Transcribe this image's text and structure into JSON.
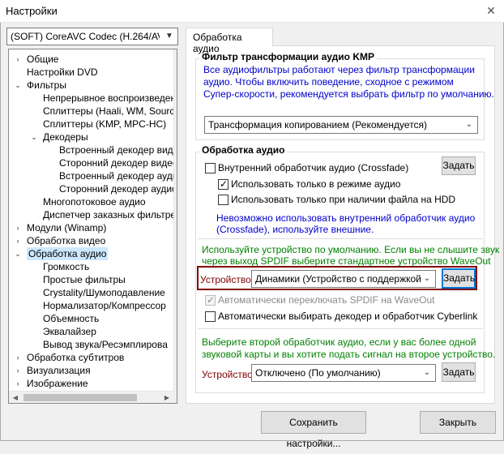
{
  "window": {
    "title": "Настройки",
    "close": "✕"
  },
  "codec_select": {
    "value": "(SOFT) CoreAVC Codec (H.264/AVC wit"
  },
  "tree": {
    "items": [
      {
        "label": "Общие",
        "expander": "›"
      },
      {
        "label": "Настройки DVD",
        "expander": ""
      },
      {
        "label": "Фильтры",
        "expander": "⌄"
      },
      {
        "label": "Непрерывное воспроизведен",
        "expander": ""
      },
      {
        "label": "Сплиттеры (Haali, WM, Source",
        "expander": ""
      },
      {
        "label": "Сплиттеры (KMP, MPC-HC)",
        "expander": ""
      },
      {
        "label": "Декодеры",
        "expander": "⌄"
      },
      {
        "label": "Встроенный декодер виде",
        "expander": ""
      },
      {
        "label": "Сторонний декодер видео",
        "expander": ""
      },
      {
        "label": "Встроенный декодер ауди",
        "expander": ""
      },
      {
        "label": "Сторонний декодер аудио",
        "expander": ""
      },
      {
        "label": "Многопотоковое аудио",
        "expander": ""
      },
      {
        "label": "Диспетчер заказных фильтре",
        "expander": ""
      },
      {
        "label": "Модули (Winamp)",
        "expander": "›"
      },
      {
        "label": "Обработка видео",
        "expander": "›"
      },
      {
        "label": "Обработка аудио",
        "expander": "⌄"
      },
      {
        "label": "Громкость",
        "expander": ""
      },
      {
        "label": "Простые фильтры",
        "expander": ""
      },
      {
        "label": "Crystality/Шумоподавление",
        "expander": ""
      },
      {
        "label": "Нормализатор/Компрессор",
        "expander": ""
      },
      {
        "label": "Объемность",
        "expander": ""
      },
      {
        "label": "Эквалайзер",
        "expander": ""
      },
      {
        "label": "Вывод звука/Ресэмплирова",
        "expander": ""
      },
      {
        "label": "Обработка субтитров",
        "expander": "›"
      },
      {
        "label": "Визуализация",
        "expander": "›"
      },
      {
        "label": "Изображение",
        "expander": "›"
      }
    ]
  },
  "tab": {
    "label": "Обработка аудио"
  },
  "transform_group": {
    "title": "Фильтр трансформации аудио KMP",
    "description_lines": [
      "Все аудиофильтры работают через фильтр трансформации",
      "аудио. Чтобы включить поведение, сходное с режимом",
      "Супер-скорости, рекомендуется выбрать фильтр по умолчанию."
    ],
    "select_value": "Трансформация копированием (Рекомендуется)"
  },
  "audio_group": {
    "title": "Обработка аудио",
    "internal_handler": {
      "label": "Внутренний обработчик аудио (Crossfade)",
      "checked": false
    },
    "assign_button": "Задать",
    "use_only_audio_mode": {
      "label": "Использовать только в режиме аудио",
      "checked": true
    },
    "use_only_hdd": {
      "label": "Использовать только при наличии файла на HDD",
      "checked": false
    },
    "warning_lines": [
      "Невозможно использовать внутренний обработчик аудио",
      "(Crossfade), используйте внешние."
    ],
    "default_device_lines": [
      "Используйте устройство по умолчанию. Если вы не слышите звук",
      "через выход SPDIF выберите стандартное устройство WaveOut"
    ],
    "device_label": "Устройство",
    "device_value": "Динамики (Устройство с поддержкой Hi",
    "device_button": "Задать",
    "auto_spdif": {
      "label": "Автоматически переключать SPDIF на WaveOut",
      "checked": true,
      "disabled": true
    },
    "auto_cyberlink": {
      "label": "Автоматически выбирать декодер и обработчик Cyberlink",
      "checked": false
    },
    "second_device_lines": [
      "Выберите второй обработчик аудио, если у вас более одной",
      "звуковой карты и вы хотите подать сигнал на второе устройство."
    ],
    "second_device_label": "Устройство",
    "second_device_value": "Отключено (По умолчанию)",
    "second_device_button": "Задать"
  },
  "footer": {
    "save": "Сохранить настройки...",
    "close": "Закрыть"
  },
  "colors": {
    "link_blue": "#0000cc",
    "hint_green": "#008000",
    "device_frame": "#800000",
    "tree_selection": "#cce8ff"
  }
}
